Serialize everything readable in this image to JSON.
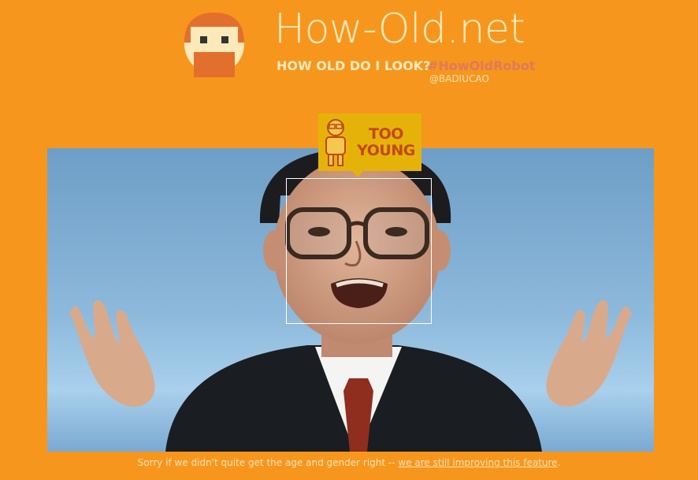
{
  "header": {
    "site_title": "How-Old.net",
    "tagline": "HOW OLD DO I LOOK?",
    "hashtag": "#HowOldRobot",
    "credit": "@BADIUCAO",
    "logo_icon": "robot-face-logo-icon"
  },
  "result": {
    "badge_line_1": "TOO",
    "badge_line_2": "YOUNG",
    "badge_icon": "old-man-icon",
    "photo_icon": "portrait-photo"
  },
  "footer": {
    "note": "Sorry if we didn't quite get the age and gender right -- ",
    "link": "we are still improving this feature",
    "end": "."
  },
  "colors": {
    "background": "#f7961d",
    "title_text": "#fdeac0",
    "hashtag": "#dc7a5e",
    "badge": "#e5b20a",
    "badge_text": "#c2480e"
  }
}
